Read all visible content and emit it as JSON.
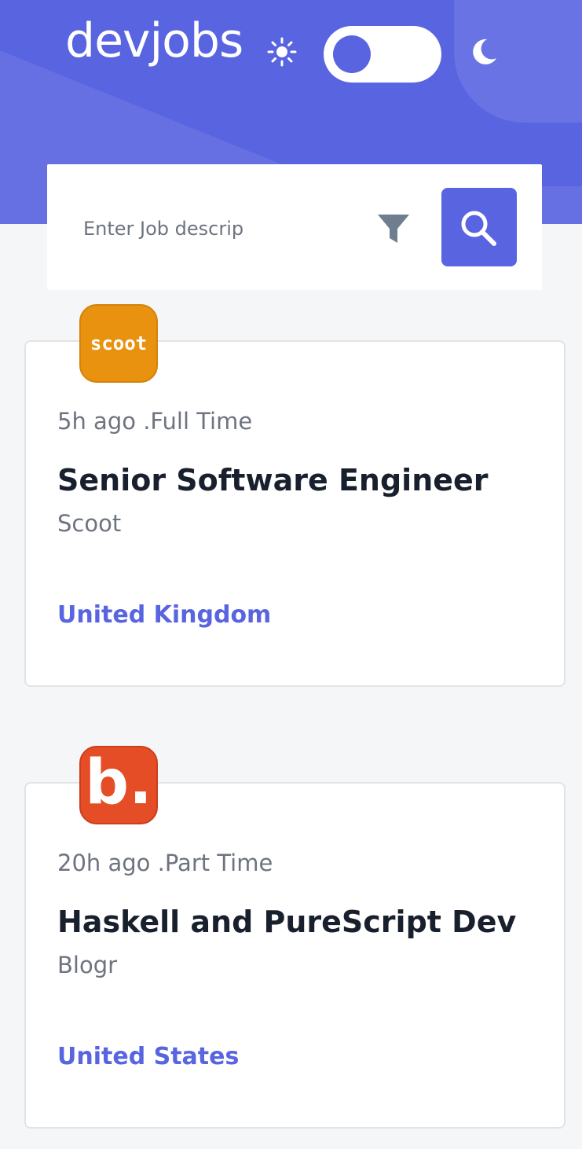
{
  "header": {
    "logo": "devjobs",
    "theme_toggle": {
      "light_icon": "sun-icon",
      "dark_icon": "moon-icon",
      "state": "light"
    }
  },
  "search": {
    "placeholder": "Enter Job descrip",
    "value": "",
    "filter_icon": "filter-icon",
    "submit_icon": "search-icon"
  },
  "jobs": [
    {
      "logo_text": "scoot",
      "logo_color": "#e99210",
      "posted": "5h ago",
      "separator": ".",
      "contract": "Full Time",
      "meta": "5h ago .Full Time",
      "position": "Senior Software Engineer",
      "company": "Scoot",
      "location": "United Kingdom"
    },
    {
      "logo_text": "b.",
      "logo_color": "#e54d26",
      "posted": "20h ago",
      "separator": ".",
      "contract": "Part Time",
      "meta": "20h ago .Part Time",
      "position": "Haskell and PureScript Dev",
      "company": "Blogr",
      "location": "United States"
    }
  ],
  "colors": {
    "primary": "#5964e0",
    "background": "#f4f6f8",
    "title": "#19202d",
    "muted": "#6e7380"
  }
}
